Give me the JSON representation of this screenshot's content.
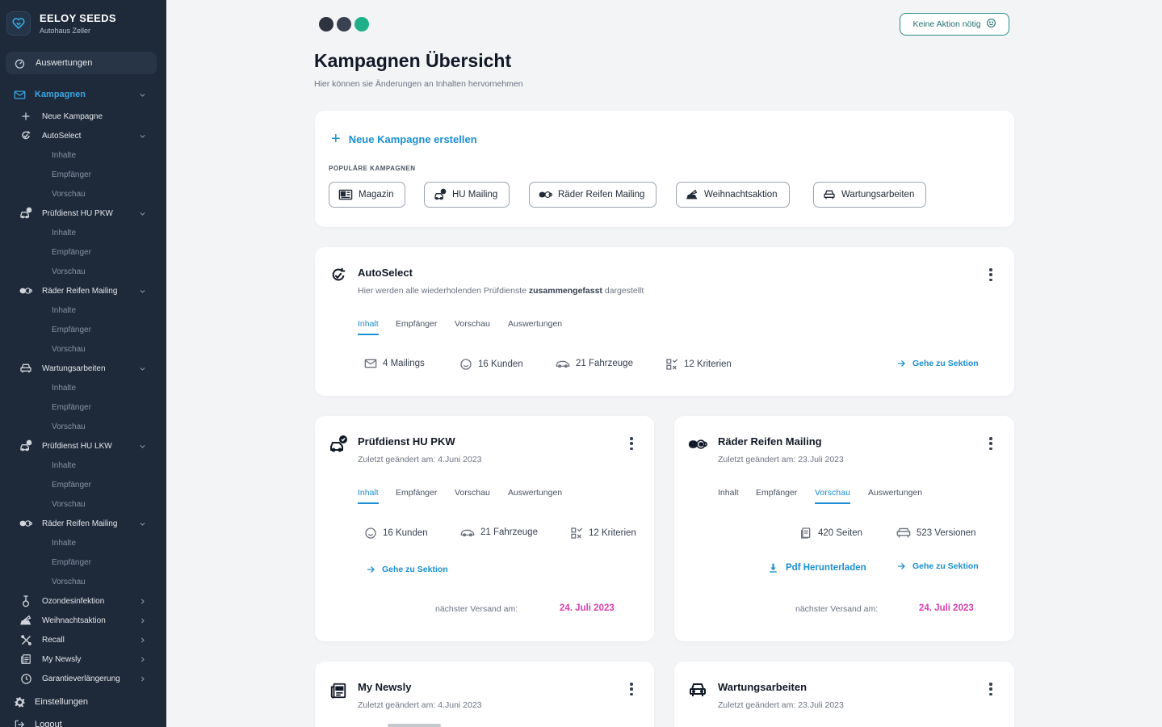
{
  "colors": {
    "sidebar_bg": "#1e2a3a",
    "accent": "#1a8fd1",
    "active_nav": "#3ba5e0",
    "date_accent": "#d63fae",
    "status_border": "#2a8f8a"
  },
  "brand": {
    "name": "EELOY SEEDS",
    "sub": "Autohaus Zeller",
    "icon": "heart-logo-icon"
  },
  "sidebar": {
    "top": {
      "label": "Auswertungen",
      "icon": "dashboard-icon"
    },
    "section": {
      "label": "Kampagnen",
      "icon": "mail-icon"
    },
    "new": {
      "label": "Neue Kampagne",
      "icon": "plus-icon"
    },
    "sub_items": {
      "inhalte": "Inhalte",
      "empfaenger": "Empfänger",
      "vorschau": "Vorschau"
    },
    "groups": [
      {
        "label": "AutoSelect",
        "icon": "autoselect-icon"
      },
      {
        "label": "Prüfdienst HU PKW",
        "icon": "car-check-icon"
      },
      {
        "label": "Räder Reifen Mailing",
        "icon": "tires-icon"
      },
      {
        "label": "Wartungsarbeiten",
        "icon": "car-front-icon"
      },
      {
        "label": "Prüfdienst HU LKW",
        "icon": "car-check-icon"
      },
      {
        "label": "Räder Reifen Mailing",
        "icon": "tires-icon"
      }
    ],
    "collapsed": [
      {
        "label": "Ozondesinfektion",
        "icon": "ozone-icon"
      },
      {
        "label": "Weihnachtsaktion",
        "icon": "christmas-car-icon"
      },
      {
        "label": "Recall",
        "icon": "tools-icon"
      },
      {
        "label": "My Newsly",
        "icon": "newsletter-icon"
      },
      {
        "label": "Garantieverlängerung",
        "icon": "clock-icon"
      }
    ],
    "settings": {
      "label": "Einstellungen",
      "icon": "gear-icon"
    },
    "logout": {
      "label": "Logout",
      "icon": "logout-icon"
    }
  },
  "header": {
    "dots": [
      "#2d3440",
      "#3a4150",
      "#1fb08a"
    ],
    "status_label": "Keine Aktion nötig",
    "title": "Kampagnen Übersicht",
    "subtitle": "Hier können sie Änderungen an Inhalten hervornehmen"
  },
  "create": {
    "label": "Neue Kampagne erstellen",
    "popular_label": "POPULÄRE KAMPAGNEN",
    "chips": [
      {
        "label": "Magazin",
        "icon": "magazine-icon"
      },
      {
        "label": "HU Mailing",
        "icon": "car-check-icon"
      },
      {
        "label": "Räder Reifen Mailing",
        "icon": "tires-icon"
      },
      {
        "label": "Weihnachtsaktion",
        "icon": "christmas-car-icon"
      },
      {
        "label": "Wartungsarbeiten",
        "icon": "car-front-icon"
      }
    ]
  },
  "tabs": {
    "inhalt": "Inhalt",
    "empfaenger": "Empfänger",
    "vorschau": "Vorschau",
    "auswertungen": "Auswertungen"
  },
  "autoselect": {
    "title": "AutoSelect",
    "desc_pre": "Hier werden alle wiederholenden Prüfdienste ",
    "desc_bold": "zusammengefasst",
    "desc_post": " dargestellt",
    "active_tab": "Inhalt",
    "stats": {
      "mailings": "4 Mailings",
      "kunden": "16 Kunden",
      "fahrzeuge": "21 Fahrzeuge",
      "kriterien": "12 Kriterien"
    },
    "goto": "Gehe zu Sektion"
  },
  "pkw": {
    "title": "Prüfdienst HU PKW",
    "changed": "Zuletzt geändert am:  4.Juni 2023",
    "active_tab": "Inhalt",
    "stats": {
      "kunden": "16 Kunden",
      "fahrzeuge": "21 Fahrzeuge",
      "kriterien": "12 Kriterien"
    },
    "goto": "Gehe zu Sektion",
    "next_label": "nächster Versand am:",
    "next_date": "24. Juli 2023"
  },
  "reifen": {
    "title": "Räder Reifen Mailing",
    "changed": "Zuletzt geändert am:  23.Juli 2023",
    "active_tab": "Vorschau",
    "stats": {
      "seiten": "420 Seiten",
      "versionen": "523 Versionen"
    },
    "pdf": "Pdf Herunterladen",
    "goto": "Gehe zu Sektion",
    "next_label": "nächster Versand am:",
    "next_date": "24. Juli 2023"
  },
  "newsly": {
    "title": "My Newsly",
    "changed": "Zuletzt geändert am:  4.Juni 2023"
  },
  "wartung": {
    "title": "Wartungsarbeiten",
    "changed": "Zuletzt geändert am:  23.Juli 2023"
  }
}
